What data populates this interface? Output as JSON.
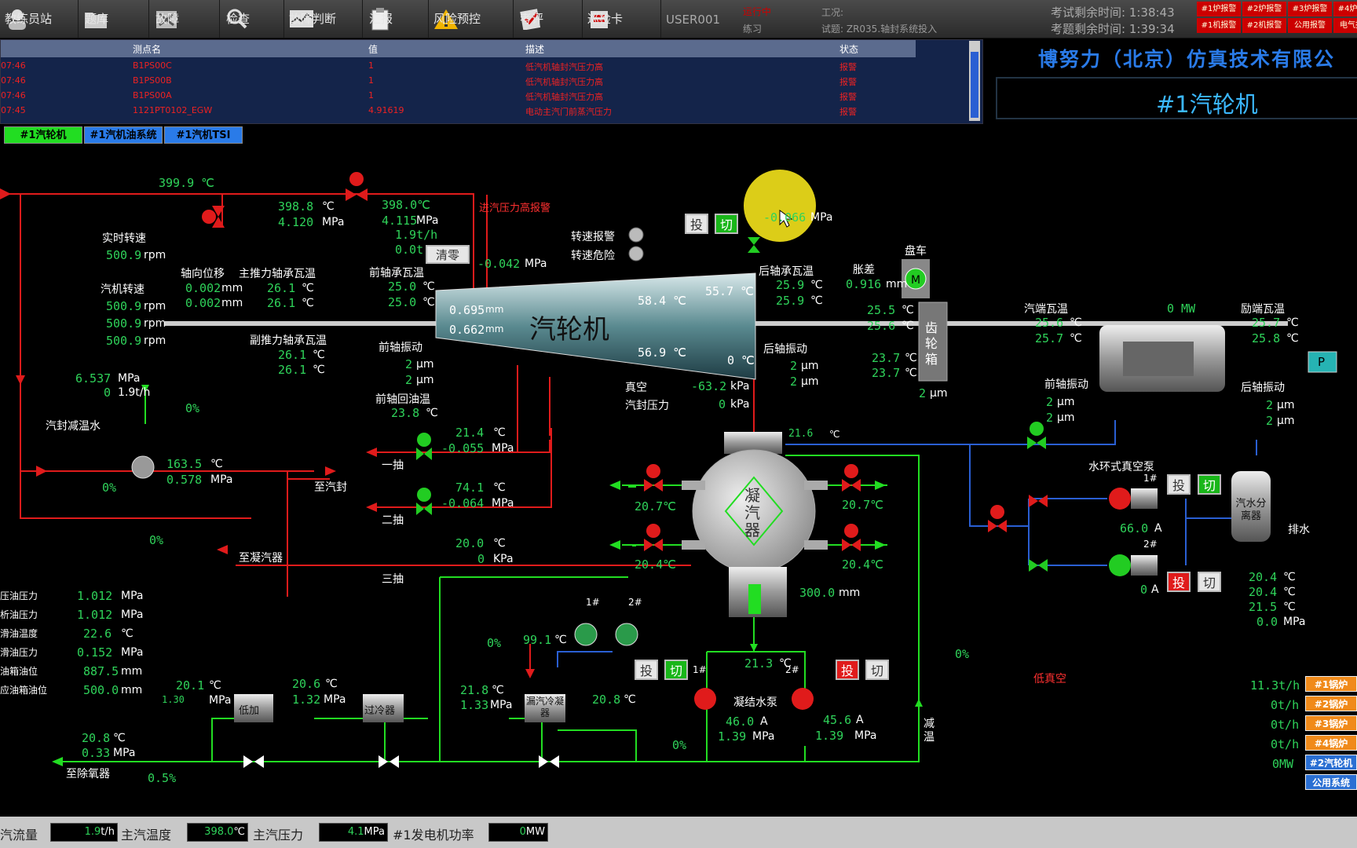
{
  "toolbar": {
    "buttons": [
      {
        "label": "教练员站"
      },
      {
        "label": "题库"
      },
      {
        "label": "故障"
      },
      {
        "label": "检查"
      },
      {
        "label": "故障判断"
      },
      {
        "label": "汇报"
      },
      {
        "label": "风险预控"
      },
      {
        "label": "考评"
      },
      {
        "label": "巡检卡"
      }
    ],
    "user": "USER001",
    "mode_status": "运行中",
    "mode": "练习",
    "condition_label": "工况:",
    "exam_title": "试题: ZR035.轴封系统投入",
    "exam_time": "考试剩余时间: 1:38:43",
    "question_time": "考题剩余时间: 1:39:34",
    "alarm_cells": [
      "#1炉报警",
      "#2炉报警",
      "#3炉报警",
      "#4炉报警",
      "#1机报警",
      "#2机报警",
      "公用报警",
      "电气报警"
    ]
  },
  "alarm_table": {
    "headers": {
      "point": "测点名",
      "value": "值",
      "desc": "描述",
      "state": "状态"
    },
    "rows": [
      {
        "time": "07:46",
        "point": "B1PS00C",
        "value": "1",
        "desc": "低汽机轴封汽压力高",
        "state": "报警"
      },
      {
        "time": "07:46",
        "point": "B1PS00B",
        "value": "1",
        "desc": "低汽机轴封汽压力高",
        "state": "报警"
      },
      {
        "time": "07:46",
        "point": "B1PS00A",
        "value": "1",
        "desc": "低汽机轴封汽压力高",
        "state": "报警"
      },
      {
        "time": "07:45",
        "point": "1121PT0102_EGW",
        "value": "4.91619",
        "desc": "电动主汽门前蒸汽压力",
        "state": "报警"
      }
    ]
  },
  "company": "博努力（北京）仿真技术有限公",
  "page_title": "#1汽轮机",
  "tabs": [
    {
      "label": "#1汽轮机",
      "color": "#22dd22"
    },
    {
      "label": "#1汽机油系统",
      "color": "#2a7be8"
    },
    {
      "label": "#1汽机TSI",
      "color": "#2a7be8"
    }
  ],
  "turbine": {
    "label": "汽轮机",
    "inner_temp1": "58.4 ℃",
    "inner_temp2": "55.7 ℃",
    "inner_temp3": "56.9 ℃",
    "inner_temp4": "0 ℃",
    "disp1": "0.695",
    "disp2": "0.662",
    "disp_unit": "mm"
  },
  "steam": {
    "main_temp": "399.9 ℃",
    "temp2": "398.8",
    "press2": "4.120",
    "temp3": "398.0℃",
    "press3": "4.115",
    "flow": "1.9t/h",
    "total": "0.0t",
    "clear_label": "清零",
    "inlet_press": "-0.042",
    "high_press_alarm": "进汽压力高报警",
    "gland_press_top": "-0.066"
  },
  "speed": {
    "realtime_label": "实时转速",
    "realtime": "500.9",
    "turbine_label": "汽机转速",
    "s1": "500.9",
    "s2": "500.9",
    "s3": "500.9",
    "unit": "rpm",
    "speed_alarm": "转速报警",
    "speed_danger": "转速危险"
  },
  "axial": {
    "label": "轴向位移",
    "v1": "0.002",
    "v2": "0.002",
    "unit": "mm",
    "main_thrust_label": "主推力轴承瓦温",
    "mt1": "26.1",
    "mt2": "26.1",
    "sub_thrust_label": "副推力轴承瓦温",
    "st1": "26.1",
    "st2": "26.1"
  },
  "front_bearing": {
    "label": "前轴承瓦温",
    "t1": "25.0",
    "t2": "25.0",
    "vib_label": "前轴振动",
    "vib1": "2",
    "vib2": "2",
    "oil_return_label": "前轴回油温",
    "oil_return": "23.8"
  },
  "rear_bearing": {
    "label": "后轴承瓦温",
    "t1": "25.9",
    "t2": "25.9",
    "vib_label": "后轴振动",
    "vib1": "2",
    "vib2": "2"
  },
  "expansion": {
    "label": "胀差",
    "value": "0.916"
  },
  "turning": {
    "label": "盘车"
  },
  "gearbox": {
    "label": "齿轮箱",
    "t1": "25.5",
    "t2": "25.6",
    "t3": "23.7",
    "t4": "23.7",
    "vib": "2"
  },
  "generator": {
    "bearing_label": "汽端瓦温",
    "b1": "25.6",
    "b2": "25.7",
    "power": "0 MW",
    "exciter_label": "励端瓦温",
    "e1": "25.7",
    "e2": "25.8",
    "front_vib_label": "前轴振动",
    "fv1": "2",
    "fv2": "2",
    "rear_vib_label": "后轴振动",
    "rv1": "2",
    "rv2": "2",
    "p_label": "P"
  },
  "vacuum": {
    "label": "真空",
    "value": "-63.2",
    "unit": "kPa",
    "gland_label": "汽封压力",
    "gland": "0"
  },
  "gland_water": {
    "label": "汽封减温水",
    "press": "6.537",
    "flow": "0",
    "pct": "0%",
    "valve_pct": "0%",
    "desup_temp": "163.5",
    "desup_press": "0.578",
    "to_gland": "至汽封",
    "bypass_pct": "0%",
    "to_condenser": "至凝汽器"
  },
  "extraction": {
    "e1_label": "一抽",
    "e1_temp": "21.4",
    "e1_press": "-0.055",
    "e2_label": "二抽",
    "e2_temp": "74.1",
    "e2_press": "-0.064",
    "e3_label": "三抽",
    "e3_temp": "20.0",
    "e3_press": "0"
  },
  "condenser": {
    "label": "凝汽器",
    "top_temp": "21.6",
    "cw_in_l1": "20.7℃",
    "cw_in_l2": "20.4℃",
    "cw_out_r1": "20.7℃",
    "cw_out_r2": "20.4℃",
    "level": "300.0",
    "level_unit": "mm"
  },
  "vacuum_pump": {
    "label": "水环式真空泵",
    "p1": "1#",
    "p2": "2#",
    "current1": "66.0",
    "current2": "0",
    "separator": "汽水分离器",
    "drain": "排水",
    "t1": "20.4",
    "t2": "20.4",
    "t3": "21.5",
    "press": "0.0",
    "on_label": "投",
    "off_label": "切"
  },
  "condensate": {
    "label": "凝结水泵",
    "temp": "21.3",
    "p1": "1#",
    "p2": "2#",
    "c1": "46.0",
    "c2": "45.6",
    "pr1": "1.39",
    "pr2": "1.39",
    "pct": "0%",
    "low_vacuum": "低真空",
    "desup": "减温",
    "desup_pct": "0%"
  },
  "oil": {
    "items": [
      {
        "label": "压油压力",
        "value": "1.012",
        "unit": "MPa"
      },
      {
        "label": "析油压力",
        "value": "1.012",
        "unit": "MPa"
      },
      {
        "label": "滑油温度",
        "value": "22.6",
        "unit": "℃"
      },
      {
        "label": "滑油压力",
        "value": "0.152",
        "unit": "MPa"
      },
      {
        "label": "油箱油位",
        "value": "887.5",
        "unit": "mm"
      },
      {
        "label": "应油箱油位",
        "value": "500.0",
        "unit": "mm"
      }
    ]
  },
  "heaters": {
    "low_label": "低加",
    "low_in_t": "20.1",
    "low_in_p": "1.30",
    "low_out_t": "20.6",
    "low_out_p": "1.32",
    "cooler_label": "过冷器",
    "gland_cooler_label": "漏汽冷凝器",
    "gc_temp": "21.8",
    "gc_press": "1.33",
    "gc_out": "20.8",
    "fan_temp": "99.1",
    "fan1": "1#",
    "fan2": "2#",
    "valve_pct": "0%",
    "deaerator_label": "至除氧器",
    "deaer_temp": "20.8",
    "deaer_press": "0.33",
    "deaer_pct": "0.5%"
  },
  "boilers": {
    "flows": [
      "11.3t/h",
      "0t/h",
      "0t/h",
      "0t/h",
      "0MW"
    ],
    "buttons": [
      "#1锅炉",
      "#2锅炉",
      "#3锅炉",
      "#4锅炉",
      "#2汽轮机",
      "公用系统"
    ]
  },
  "statusbar": {
    "items": [
      {
        "label": "汽流量",
        "value": "1.9",
        "unit": "t/h"
      },
      {
        "label": "主汽温度",
        "value": "398.0",
        "unit": "℃"
      },
      {
        "label": "主汽压力",
        "value": "4.1",
        "unit": "MPa"
      },
      {
        "label": "#1发电机功率",
        "value": "0",
        "unit": "MW"
      }
    ]
  },
  "buttons": {
    "on": "投",
    "off": "切"
  },
  "units": {
    "c": "℃",
    "mpa": "MPa",
    "um": "μm",
    "a": "A",
    "kpa": "KPa",
    "mm": "mm"
  },
  "colors": {
    "steam": "#e01b1b",
    "water": "#22dd22",
    "cooling": "#2a5fd3",
    "value": "#2fd35a"
  }
}
